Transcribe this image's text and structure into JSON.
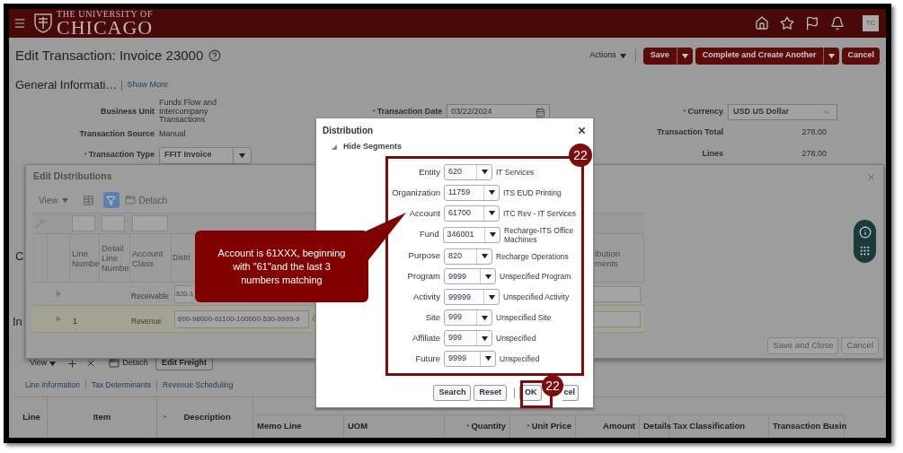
{
  "header": {
    "logo_line1": "THE UNIVERSITY OF",
    "logo_line2": "CHICAGO",
    "avatar": "TC"
  },
  "page": {
    "title": "Edit Transaction: Invoice 23000",
    "actions": "Actions",
    "buttons": [
      {
        "label": "Save",
        "kind": "split"
      },
      {
        "label": "Complete and Create Another",
        "kind": "split"
      },
      {
        "label": "Cancel",
        "kind": "plain"
      }
    ],
    "section_title": "General Informati…",
    "show_more": "Show More"
  },
  "form": {
    "left": [
      {
        "label": "Business Unit",
        "value": "Funds Flow and Intercompany Transactions",
        "kind": "text"
      },
      {
        "label": "Transaction Source",
        "value": "Manual",
        "kind": "text"
      },
      {
        "mark": "*",
        "label": "Transaction Type",
        "value": "FFIT Invoice",
        "kind": "select"
      }
    ],
    "middle": [
      {
        "mark": "*",
        "label": "Transaction Date",
        "value": "03/22/2024",
        "kind": "date"
      }
    ],
    "right": [
      {
        "mark": "*",
        "label": "Currency",
        "value": "USD US Dollar",
        "kind": "combo"
      },
      {
        "label": "Transaction Total",
        "value": "278.00",
        "kind": "amount"
      },
      {
        "label": "Lines",
        "value": "278.00",
        "kind": "amount"
      }
    ]
  },
  "partial_headings": [
    "C",
    "In"
  ],
  "lines": {
    "view": "View",
    "detach": "Detach",
    "edit_freight": "Edit Freight",
    "tabs": [
      "Line Information",
      "Tax Determinants",
      "Revenue Scheduling"
    ],
    "columns": [
      {
        "label": "Line",
        "kind": "tall"
      },
      {
        "label": "Item",
        "kind": "tall"
      },
      {
        "mark": "*",
        "label": "Description",
        "kind": "tall"
      },
      {
        "label": "Memo Line",
        "kind": "sub"
      },
      {
        "label": "UOM",
        "kind": "sub"
      },
      {
        "mark": "*",
        "label": "Quantity",
        "kind": "sub"
      },
      {
        "mark": "*",
        "label": "Unit Price",
        "kind": "sub"
      },
      {
        "label": "Amount",
        "kind": "sub"
      },
      {
        "label": "Details",
        "kind": "sub"
      },
      {
        "label": "Tax Classification",
        "kind": "sub"
      },
      {
        "label": "Transaction Busin",
        "kind": "sub"
      }
    ]
  },
  "edit_distributions": {
    "title": "Edit Distributions",
    "view": "View",
    "detach": "Detach",
    "columns": [
      "Line Numbe",
      "Detail Line Numbe",
      "Account Class",
      "Distri",
      "ibution ments"
    ],
    "rows": [
      {
        "line": "",
        "account_class": "Receivable",
        "distribution": "620-1",
        "selected": false,
        "kind": "clipped"
      },
      {
        "line": "1",
        "account_class": "Revenue",
        "distribution": "600-98000-61100-100000-530-9999-9",
        "selected": true,
        "kind": "full"
      }
    ],
    "buttons": [
      "Save and Close",
      "Cancel"
    ]
  },
  "distribution": {
    "title": "Distribution",
    "toggle": "Hide Segments",
    "segments": [
      {
        "label": "Entity",
        "value": "620",
        "description": "IT Services"
      },
      {
        "label": "Organization",
        "value": "11759",
        "description": "ITS EUD Printing"
      },
      {
        "label": "Account",
        "value": "61700",
        "description": "ITC Rev - IT Services"
      },
      {
        "label": "Fund",
        "value": "346001",
        "description": "Recharge-ITS Office Machines"
      },
      {
        "label": "Purpose",
        "value": "820",
        "description": "Recharge Operations"
      },
      {
        "label": "Program",
        "value": "9999",
        "description": "Unspecified Program"
      },
      {
        "label": "Activity",
        "value": "99999",
        "description": "Unspecified Activity"
      },
      {
        "label": "Site",
        "value": "999",
        "description": "Unspecified Site"
      },
      {
        "label": "Affiliate",
        "value": "999",
        "description": "Unspecified"
      },
      {
        "label": "Future",
        "value": "9999",
        "description": "Unspecified"
      }
    ],
    "buttons": [
      "Search",
      "Reset",
      "OK",
      "cel"
    ],
    "badges": [
      "22",
      "22"
    ]
  },
  "callout": "Account is 61XXX, beginning with \"61\"and the last 3 numbers matching"
}
